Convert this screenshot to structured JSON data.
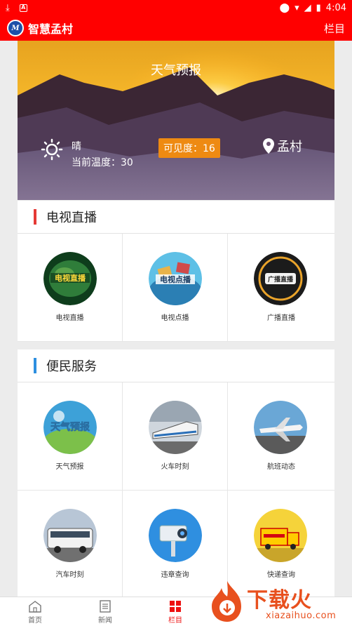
{
  "status": {
    "time": "4:04"
  },
  "appbar": {
    "logo_text": "M",
    "title": "智慧孟村",
    "column_link": "栏目"
  },
  "weather": {
    "title": "天气预报",
    "condition": "晴",
    "temperature": "当前温度：30",
    "visibility": "可见度：16",
    "location": "孟村"
  },
  "tv_section": {
    "title": "电视直播",
    "accent": "#e53935",
    "items": [
      {
        "label": "电视直播",
        "icon": "tv-live-icon"
      },
      {
        "label": "电视点播",
        "icon": "tv-vod-icon"
      },
      {
        "label": "广播直播",
        "icon": "radio-live-icon"
      }
    ]
  },
  "service_section": {
    "title": "便民服务",
    "accent": "#2d8fe0",
    "items": [
      {
        "label": "天气预报",
        "icon": "weather-icon"
      },
      {
        "label": "火车时刻",
        "icon": "train-icon"
      },
      {
        "label": "航班动态",
        "icon": "airplane-icon"
      },
      {
        "label": "汽车时刻",
        "icon": "bus-icon"
      },
      {
        "label": "违章查询",
        "icon": "traffic-camera-icon"
      },
      {
        "label": "快递查询",
        "icon": "delivery-truck-icon"
      }
    ]
  },
  "bottom_nav": [
    {
      "label": "首页",
      "icon": "home-icon"
    },
    {
      "label": "新闻",
      "icon": "news-icon"
    },
    {
      "label": "栏目",
      "icon": "grid-icon",
      "active": true
    }
  ],
  "watermark": {
    "brand": "下载火",
    "url": "xiazaihuo.com"
  },
  "colors": {
    "primary": "#ff0000",
    "visibility_badge": "#ee8a12",
    "nav_active": "#e11"
  }
}
